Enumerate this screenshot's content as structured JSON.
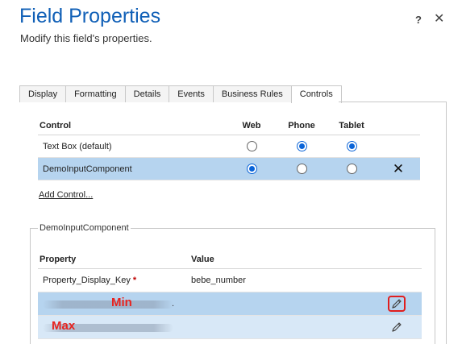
{
  "header": {
    "title": "Field Properties",
    "subtitle": "Modify this field's properties.",
    "help_label": "?",
    "close_label": "✕"
  },
  "tabs": [
    {
      "label": "Display",
      "active": false
    },
    {
      "label": "Formatting",
      "active": false
    },
    {
      "label": "Details",
      "active": false
    },
    {
      "label": "Events",
      "active": false
    },
    {
      "label": "Business Rules",
      "active": false
    },
    {
      "label": "Controls",
      "active": true
    }
  ],
  "controls_table": {
    "headers": {
      "control": "Control",
      "web": "Web",
      "phone": "Phone",
      "tablet": "Tablet"
    },
    "rows": [
      {
        "name": "Text Box (default)",
        "web": false,
        "phone": true,
        "tablet": true,
        "selected": false
      },
      {
        "name": "DemoInputComponent",
        "web": true,
        "phone": false,
        "tablet": false,
        "selected": true,
        "delete_icon": "✕"
      }
    ],
    "add_control_label": "Add Control..."
  },
  "component_section": {
    "legend": "DemoInputComponent",
    "headers": {
      "property": "Property",
      "value": "Value"
    },
    "rows": [
      {
        "name": "Property_Display_Key",
        "required_mark": "*",
        "value": "bebe_number"
      },
      {
        "annotation": "Min",
        "trailing": ".",
        "value": "",
        "edit_icon": "pencil-icon",
        "edit_highlighted": true
      },
      {
        "annotation": "Max",
        "value": "",
        "edit_icon": "pencil-icon",
        "edit_highlighted": false
      }
    ]
  },
  "colors": {
    "title_blue": "#1160b7",
    "selected_row": "#b6d4ef",
    "annotation_red": "#e8231f",
    "radio_blue": "#0a64d8"
  }
}
